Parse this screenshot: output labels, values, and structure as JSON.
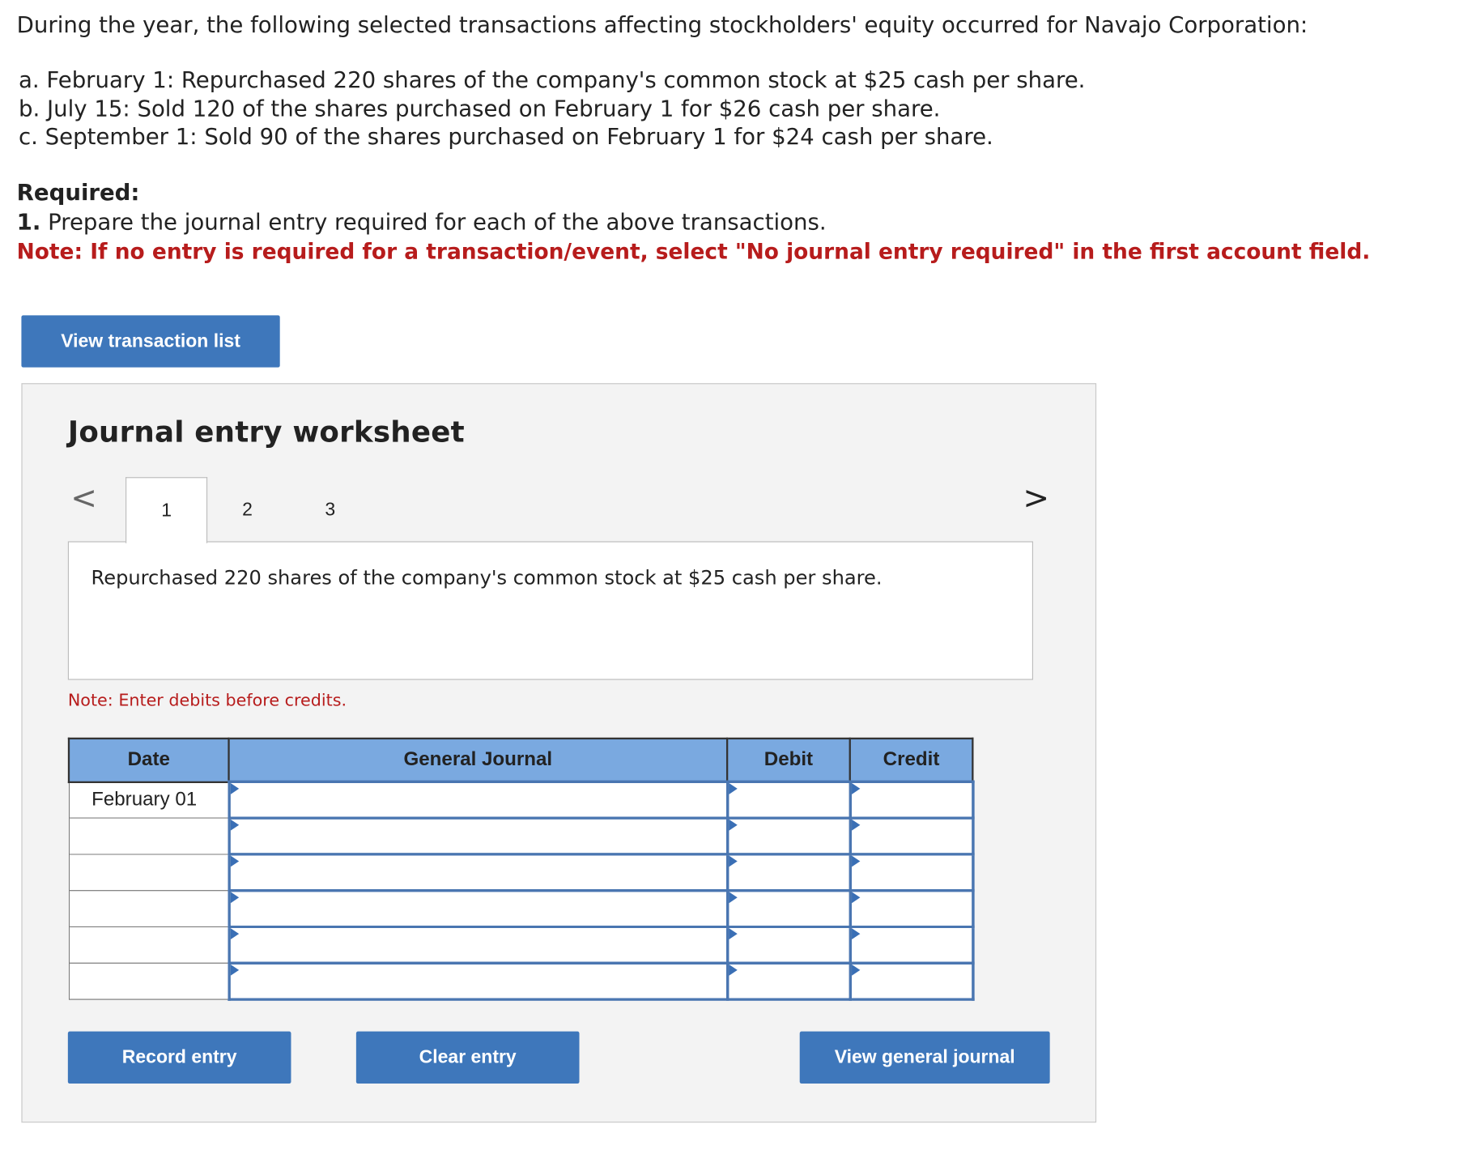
{
  "problem": {
    "intro": "During the year, the following selected transactions affecting stockholders' equity occurred for Navajo Corporation:",
    "transactions": [
      "a. February 1: Repurchased 220 shares of the company's common stock at $25 cash per share.",
      "b. July 15: Sold 120 of the shares purchased on February 1 for $26 cash per share.",
      "c. September 1: Sold 90 of the shares purchased on February 1 for $24 cash per share."
    ],
    "required_label": "Required:",
    "req_number": "1.",
    "req_text": "Prepare the journal entry required for each of the above transactions.",
    "note": "Note: If no entry is required for a transaction/event, select \"No journal entry required\" in the first account field."
  },
  "buttons": {
    "view_transaction_list": "View transaction list",
    "record_entry": "Record entry",
    "clear_entry": "Clear entry",
    "view_general_journal": "View general journal"
  },
  "worksheet": {
    "title": "Journal entry worksheet",
    "tabs": [
      "1",
      "2",
      "3"
    ],
    "active_tab": 0,
    "prev_icon": "<",
    "next_icon": ">",
    "description": "Repurchased 220 shares of the company's common stock at $25 cash per share.",
    "debit_note": "Note: Enter debits before credits."
  },
  "journal": {
    "headers": {
      "date": "Date",
      "account": "General Journal",
      "debit": "Debit",
      "credit": "Credit"
    },
    "rows": [
      {
        "date": "February 01",
        "account": "",
        "debit": "",
        "credit": ""
      },
      {
        "date": "",
        "account": "",
        "debit": "",
        "credit": ""
      },
      {
        "date": "",
        "account": "",
        "debit": "",
        "credit": ""
      },
      {
        "date": "",
        "account": "",
        "debit": "",
        "credit": ""
      },
      {
        "date": "",
        "account": "",
        "debit": "",
        "credit": ""
      },
      {
        "date": "",
        "account": "",
        "debit": "",
        "credit": ""
      }
    ]
  },
  "colors": {
    "button": "#3e77bb",
    "header": "#7aa9e0",
    "note_red": "#b71c1c"
  }
}
